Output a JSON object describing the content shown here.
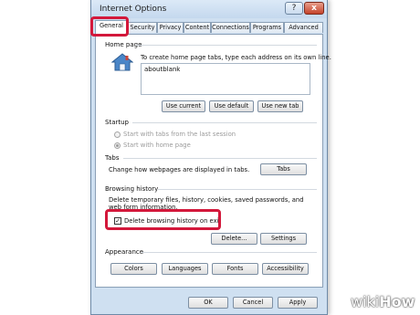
{
  "window": {
    "title": "Internet Options",
    "help_label": "?",
    "close_label": "x"
  },
  "tabs": [
    {
      "label": "General",
      "active": true
    },
    {
      "label": "Security",
      "active": false
    },
    {
      "label": "Privacy",
      "active": false
    },
    {
      "label": "Content",
      "active": false
    },
    {
      "label": "Connections",
      "active": false
    },
    {
      "label": "Programs",
      "active": false
    },
    {
      "label": "Advanced",
      "active": false
    }
  ],
  "home_page": {
    "heading": "Home page",
    "description": "To create home page tabs, type each address on its own line.",
    "address_value": "aboutblank",
    "use_current": "Use current",
    "use_default": "Use default",
    "use_new_tab": "Use new tab",
    "icon": "house-icon"
  },
  "startup": {
    "heading": "Startup",
    "option_last_session": "Start with tabs from the last session",
    "option_home_page": "Start with home page",
    "selected": "home_page"
  },
  "tabs_section": {
    "heading": "Tabs",
    "description": "Change how webpages are displayed in tabs.",
    "button": "Tabs"
  },
  "browsing_history": {
    "heading": "Browsing history",
    "description_line1": "Delete temporary files, history, cookies, saved passwords, and",
    "description_line2": "web form information.",
    "checkbox_label": "Delete browsing history on exit",
    "checkbox_checked": true,
    "checkbox_mark": "✓",
    "delete_button": "Delete...",
    "settings_button": "Settings"
  },
  "appearance": {
    "heading": "Appearance",
    "colors": "Colors",
    "languages": "Languages",
    "fonts": "Fonts",
    "accessibility": "Accessibility"
  },
  "footer": {
    "ok": "OK",
    "cancel": "Cancel",
    "apply": "Apply"
  },
  "watermark": {
    "part1": "wiki",
    "part2": "How"
  },
  "colors": {
    "highlight": "#d3183b",
    "dialog_bg": "#cfe0f1",
    "panel_bg": "#ffffff"
  }
}
